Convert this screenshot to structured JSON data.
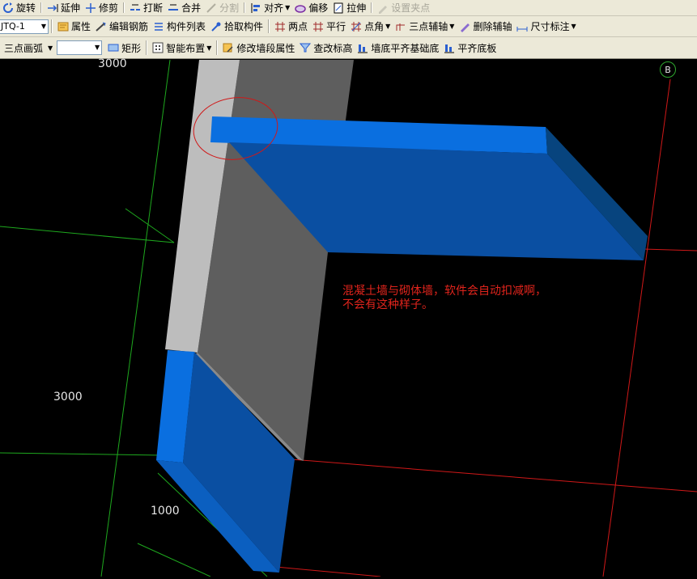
{
  "toolbar1": {
    "rotate": "旋转",
    "extend": "延伸",
    "trim": "修剪",
    "break": "打断",
    "merge": "合并",
    "split": "分割",
    "align": "对齐",
    "offset": "偏移",
    "stretch": "拉伸",
    "set_grip": "设置夹点"
  },
  "toolbar2": {
    "component_combo": "JTQ-1",
    "properties": "属性",
    "edit_rebar": "编辑钢筋",
    "component_list": "构件列表",
    "pick_component": "拾取构件",
    "two_points": "两点",
    "parallel": "平行",
    "point_angle": "点角",
    "three_point_axis": "三点辅轴",
    "delete_axis": "删除辅轴",
    "dimension": "尺寸标注"
  },
  "toolbar3": {
    "arc_mode": "三点画弧",
    "style_combo": "",
    "rectangle": "矩形",
    "smart_layout": "智能布置",
    "modify_wall_props": "修改墙段属性",
    "check_elevation": "查改标高",
    "align_foundation": "墙底平齐基础底",
    "align_slab": "平齐底板"
  },
  "viewport": {
    "dim_top": "3000",
    "dim_left": "3000",
    "dim_bottom": "1000",
    "axis_label": "B",
    "annotation_line1": "混凝土墙与砌体墙，软件会自动扣减啊，",
    "annotation_line2": "不会有这种样子。",
    "colors": {
      "concrete_wall": "#0a6fe0",
      "masonry_wall": "#bdbdbd",
      "grid_green": "#1ea81e",
      "grid_red": "#d01818"
    }
  }
}
